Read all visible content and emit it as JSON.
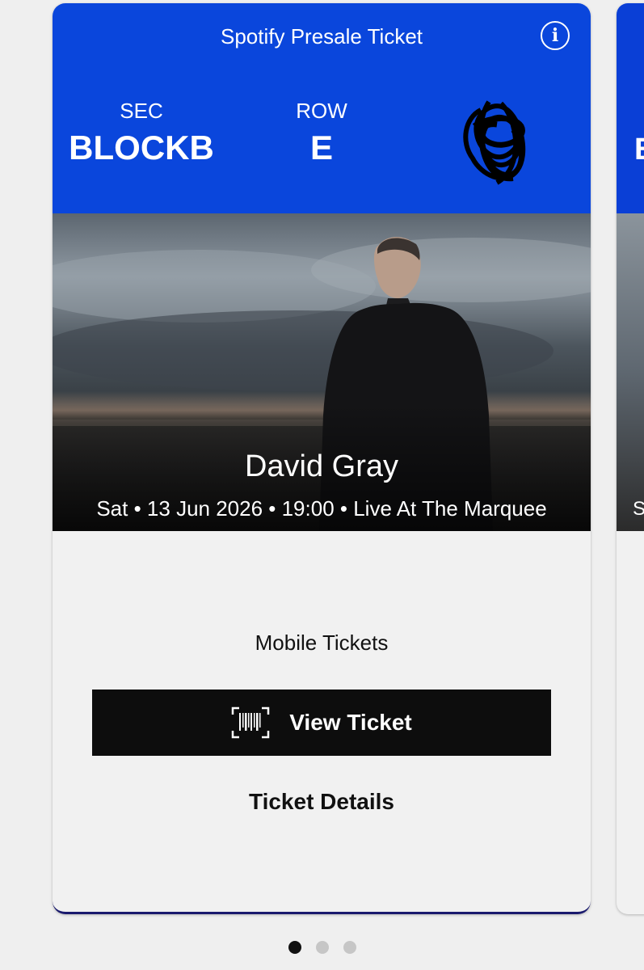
{
  "ticket": {
    "title": "Spotify Presale Ticket",
    "sec_label": "SEC",
    "sec_value": "BLOCKB",
    "row_label": "ROW",
    "row_value": "E",
    "artist": "David Gray",
    "event_line": "Sat • 13 Jun 2026 • 19:00 • Live At The Marquee",
    "mobile_label": "Mobile Tickets",
    "view_button_label": "View Ticket",
    "details_label": "Ticket Details"
  },
  "next_card": {
    "letter": "E",
    "line_start": "S"
  },
  "pager": {
    "count": 3,
    "active_index": 0
  },
  "icons": {
    "info": "info-icon",
    "barcode": "barcode-icon"
  },
  "colors": {
    "header_blue": "#0a46dc",
    "button_black": "#0d0d0d",
    "page_bg": "#efefef"
  }
}
